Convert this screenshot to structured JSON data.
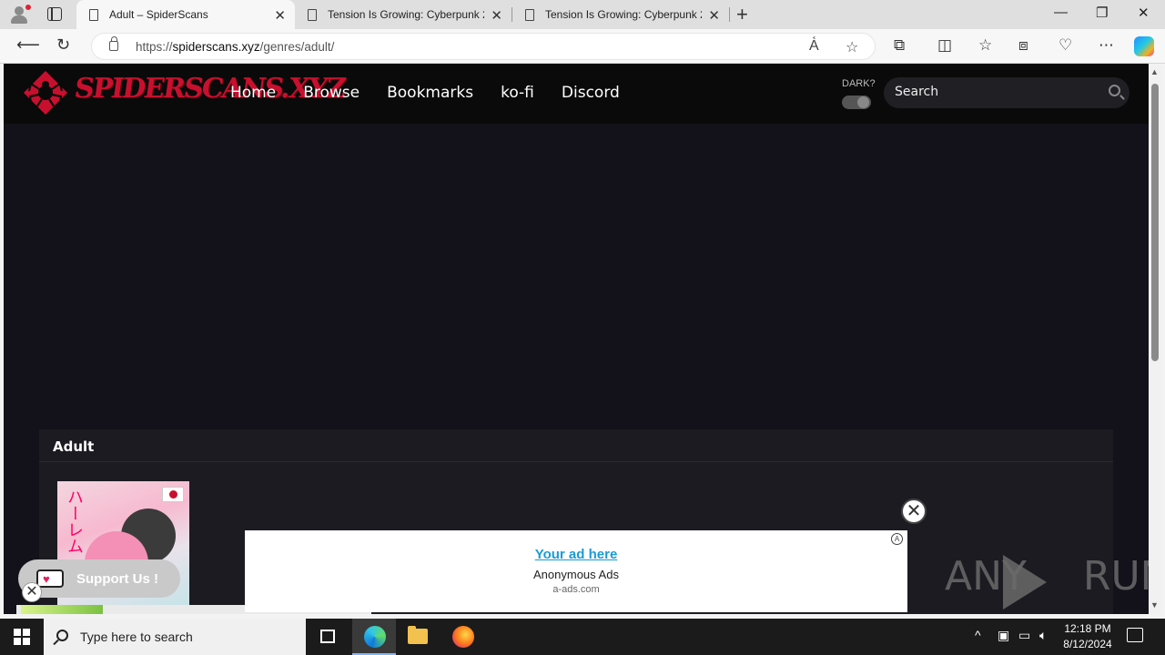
{
  "browser": {
    "tabs": [
      {
        "title": "Adult – SpiderScans",
        "active": true
      },
      {
        "title": "Tension Is Growing: Cyberpunk 2",
        "active": false
      },
      {
        "title": "Tension Is Growing: Cyberpunk 2",
        "active": false
      }
    ],
    "url_prefix": "https://",
    "url_host": "spiderscans.xyz",
    "url_path": "/genres/adult/"
  },
  "site": {
    "logo_text": "SPIDERSCANS.XYZ",
    "nav": [
      "Home",
      "Browse",
      "Bookmarks",
      "ko-fi",
      "Discord"
    ],
    "dark_label": "DARK?",
    "search_placeholder": "Search",
    "section_title": "Adult",
    "card_kana": "ハーレム",
    "support_label": "Support Us !"
  },
  "ad": {
    "link": "Your ad here",
    "line2": "Anonymous Ads",
    "line3": "a-ads.com"
  },
  "watermark": {
    "left": "ANY",
    "right": "RUN"
  },
  "taskbar": {
    "search_placeholder": "Type here to search",
    "time": "12:18 PM",
    "date": "8/12/2024"
  },
  "colors": {
    "brand_red": "#c8102e",
    "page_bg": "#13121a",
    "header_bg": "#0a0a0a",
    "ad_link": "#1a9bd7"
  }
}
